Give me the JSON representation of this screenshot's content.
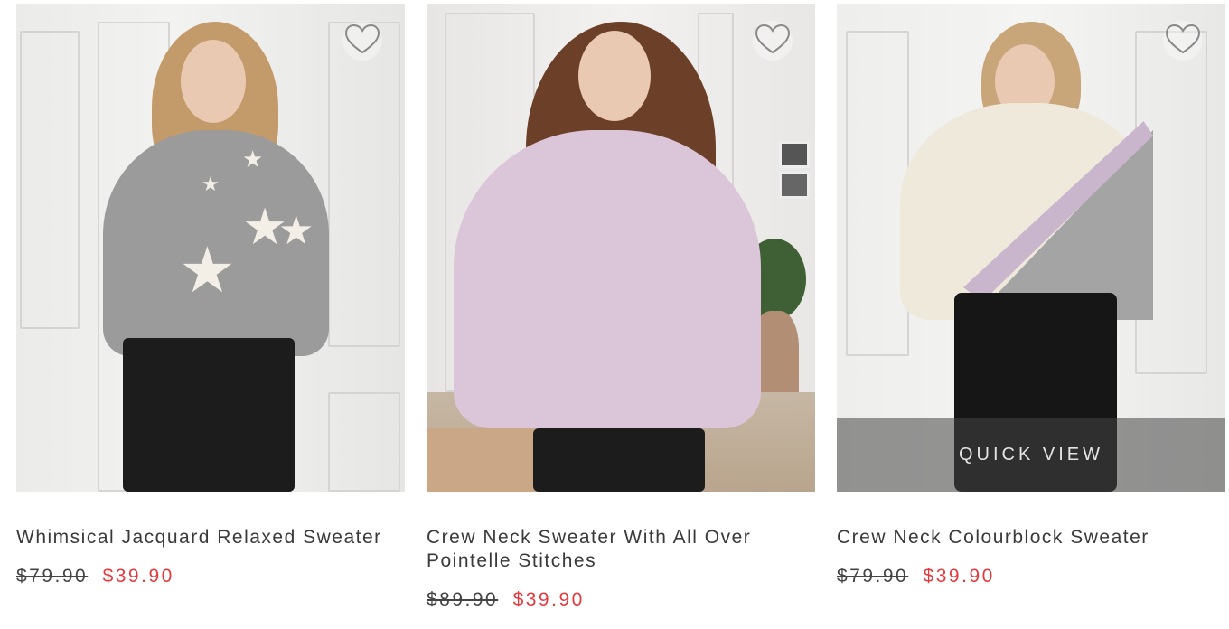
{
  "accent_sale_color": "#e5393e",
  "products": [
    {
      "title": "Whimsical Jacquard Relaxed Sweater",
      "original_price": "$79.90",
      "sale_price": "$39.90",
      "wishlist_icon": "heart-outline-icon"
    },
    {
      "title": "Crew Neck Sweater With All Over Pointelle Stitches",
      "original_price": "$89.90",
      "sale_price": "$39.90",
      "wishlist_icon": "heart-outline-icon"
    },
    {
      "title": "Crew Neck Colourblock Sweater",
      "original_price": "$79.90",
      "sale_price": "$39.90",
      "wishlist_icon": "heart-outline-icon",
      "quick_view_label": "QUICK VIEW"
    }
  ]
}
